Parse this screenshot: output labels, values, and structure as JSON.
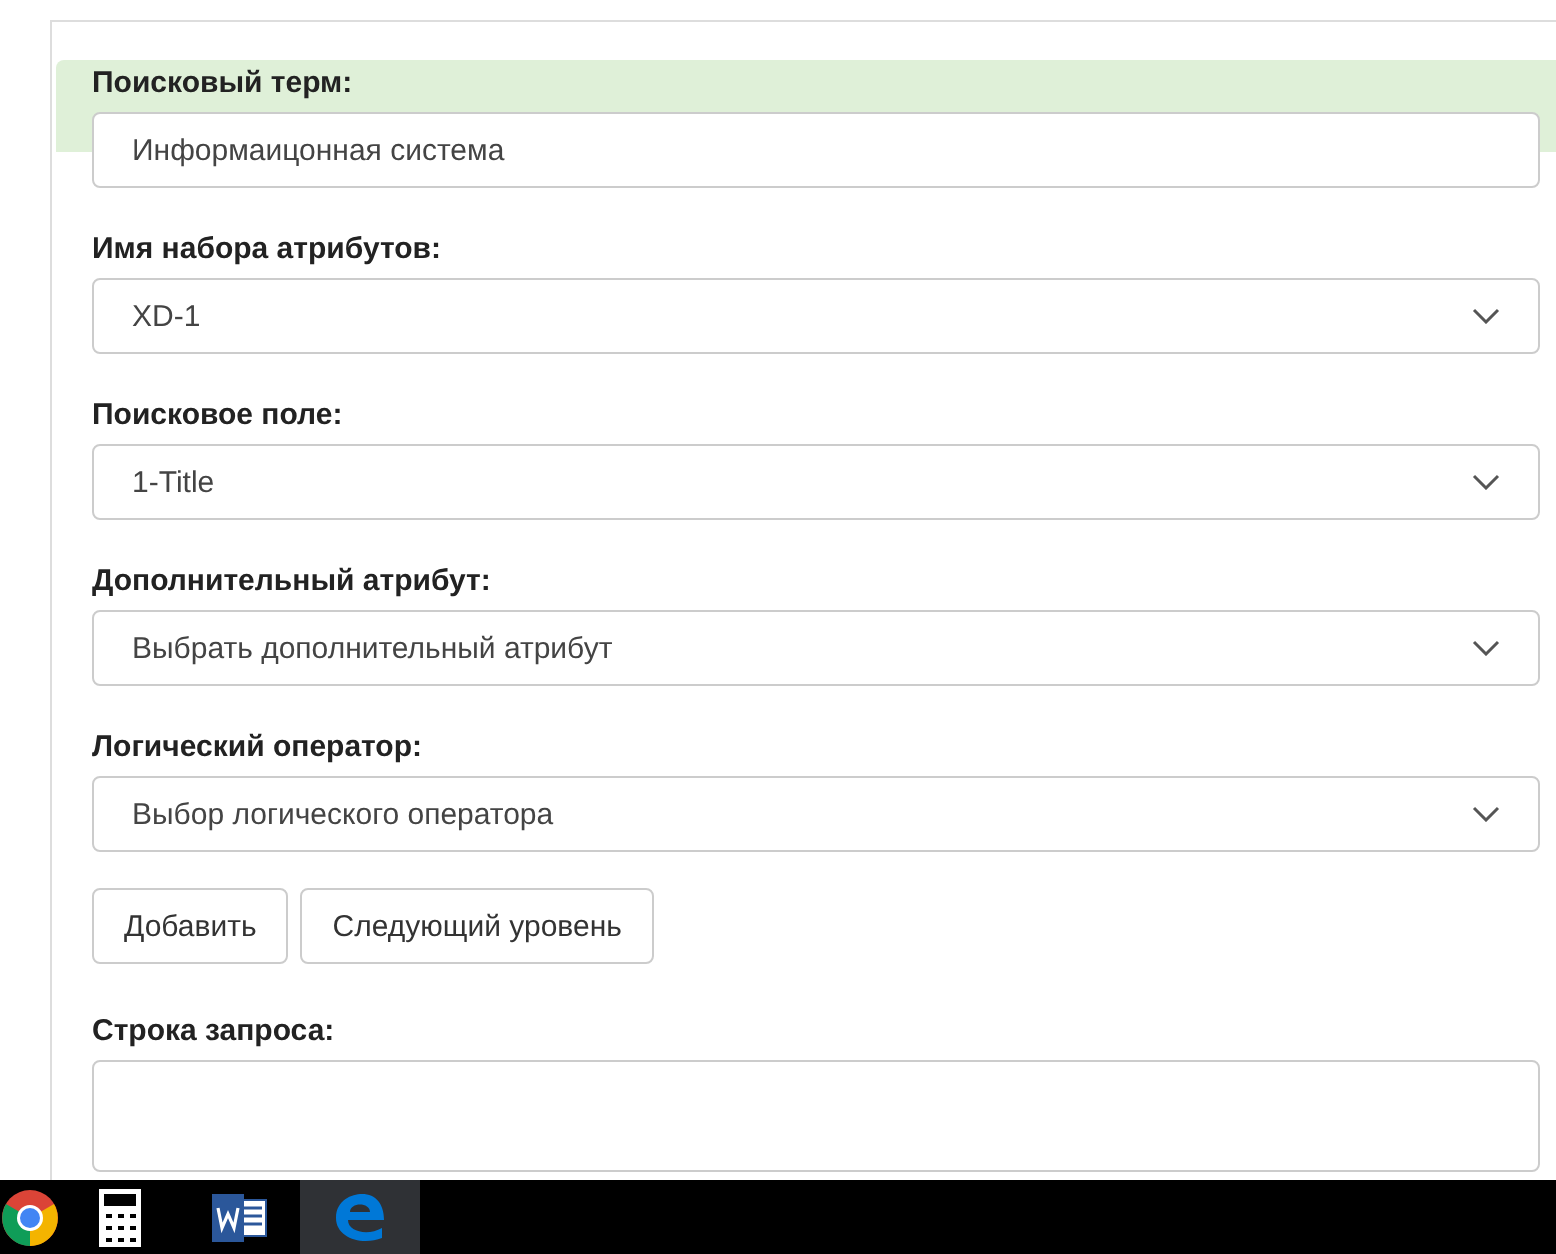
{
  "form": {
    "fields": [
      {
        "kind": "text",
        "label": "Поисковый терм:",
        "value": "Информаицонная система",
        "highlighted": true
      },
      {
        "kind": "select",
        "label": "Имя набора атрибутов:",
        "value": "XD-1",
        "highlighted": false
      },
      {
        "kind": "select",
        "label": "Поисковое поле:",
        "value": "1-Title",
        "highlighted": false
      },
      {
        "kind": "select",
        "label": "Дополнительный атрибут:",
        "value": "Выбрать дополнительный атрибут",
        "highlighted": false
      },
      {
        "kind": "select",
        "label": "Логический оператор:",
        "value": "Выбор логического оператора",
        "highlighted": false
      }
    ],
    "buttons": [
      "Добавить",
      "Следующий уровень"
    ],
    "query": {
      "label": "Строка запроса:"
    }
  },
  "taskbar": {
    "items": [
      {
        "kind": "chrome",
        "selected": false
      },
      {
        "kind": "calculator",
        "selected": false
      },
      {
        "kind": "word",
        "selected": false
      },
      {
        "kind": "edge",
        "selected": true
      }
    ]
  }
}
